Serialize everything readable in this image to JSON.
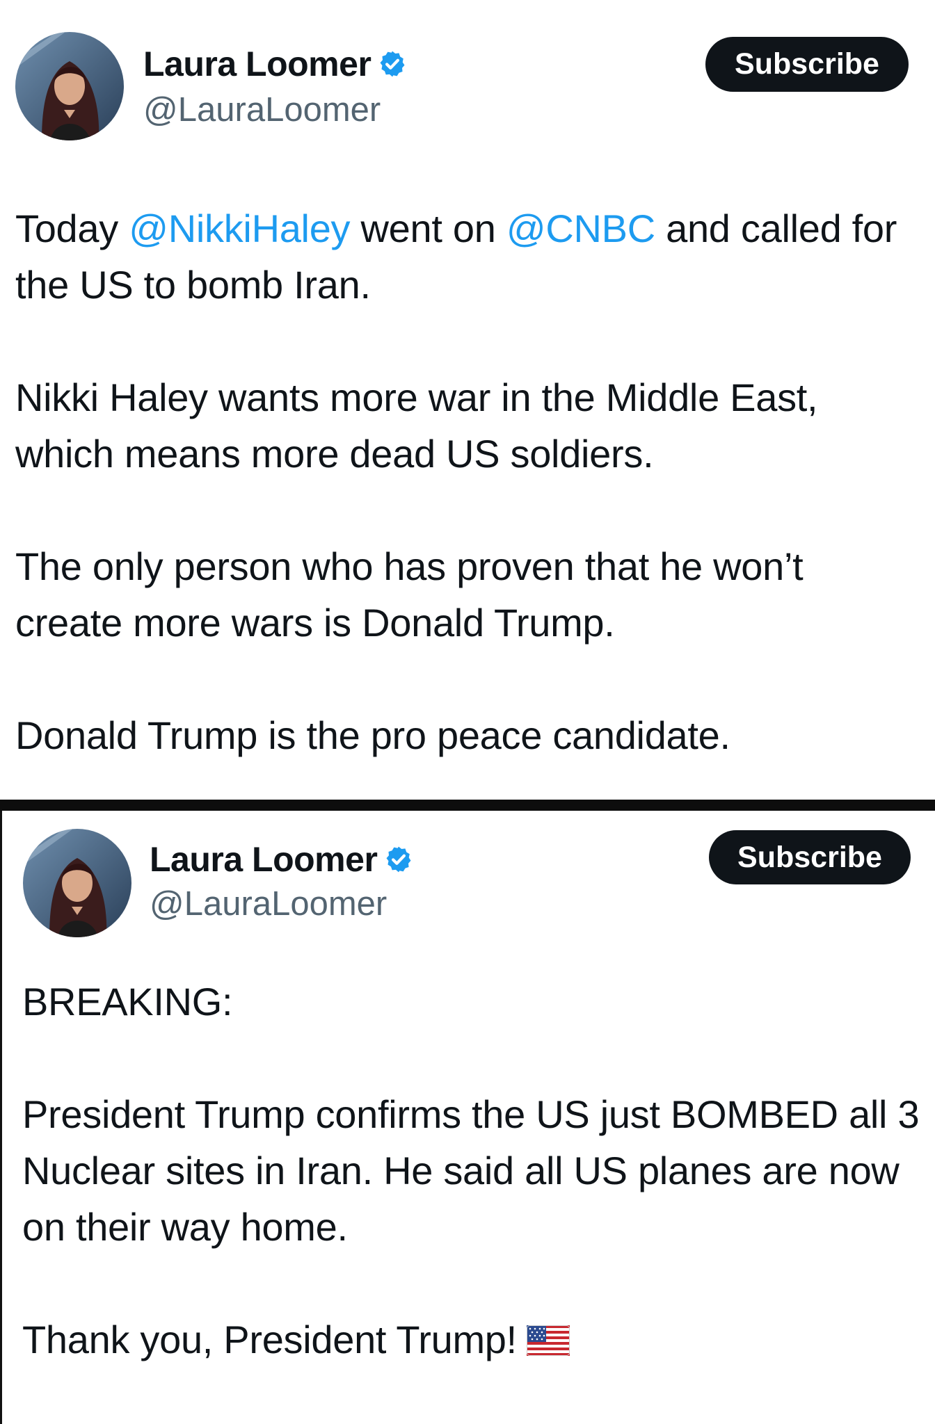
{
  "tweets": [
    {
      "author": {
        "name": "Laura Loomer",
        "handle": "@LauraLoomer"
      },
      "subscribe_label": "Subscribe",
      "text": {
        "p1_a": "Today ",
        "mention1": "@NikkiHaley",
        "p1_b": " went on ",
        "mention2": "@CNBC",
        "p1_c": " and called for the US to bomb Iran.",
        "p2": "Nikki Haley wants more war in the Middle East, which means more dead US soldiers.",
        "p3": "The only person who has proven that he won’t create more wars is Donald Trump.",
        "p4": "Donald Trump is the pro peace candidate."
      }
    },
    {
      "author": {
        "name": "Laura Loomer",
        "handle": "@LauraLoomer"
      },
      "subscribe_label": "Subscribe",
      "text": {
        "p1": "BREAKING:",
        "p2": "President Trump confirms the US just BOMBED all 3 Nuclear sites in Iran. He said all US planes are now on their way home.",
        "p3": "Thank you, President Trump!"
      }
    }
  ],
  "icons": {
    "verified": "verified-badge-icon",
    "flag": "us-flag-emoji"
  },
  "colors": {
    "mention": "#1d9bf0",
    "verified": "#1d9bf0",
    "handle": "#536471",
    "button": "#0f1419"
  }
}
